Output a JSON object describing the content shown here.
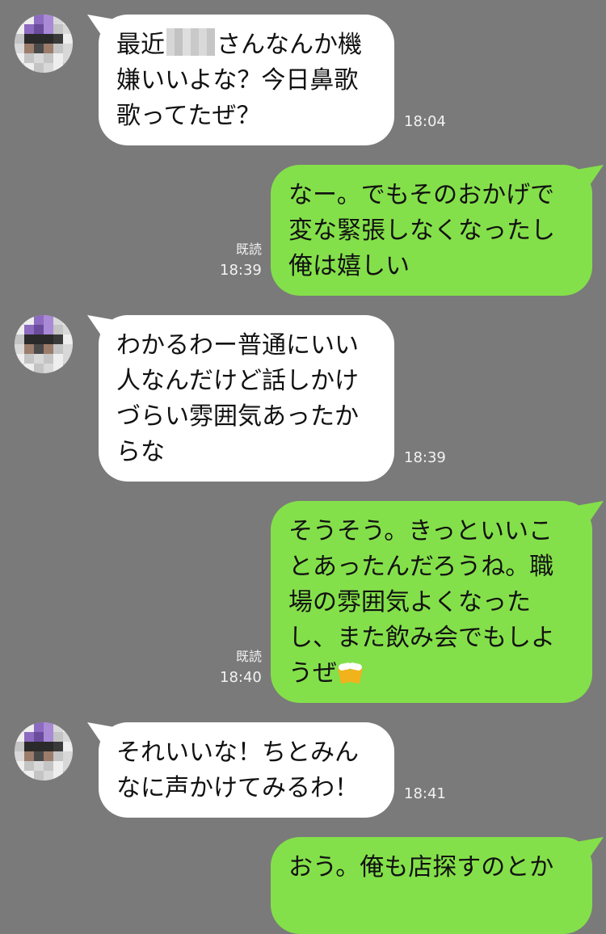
{
  "messages": [
    {
      "side": "in",
      "lines": [
        "最近",
        "さんなんか機",
        "嫌いいよな？今日鼻歌",
        "歌ってたぜ？"
      ],
      "redacted_name": true,
      "time": "18:04"
    },
    {
      "side": "out",
      "lines": [
        "なー。でもそのおかげで",
        "変な緊張しなくなったし",
        "俺は嬉しい"
      ],
      "read_label": "既読",
      "time": "18:39"
    },
    {
      "side": "in",
      "lines": [
        "わかるわー普通にいい",
        "人なんだけど話しかけ",
        "づらい雰囲気あったか",
        "らな"
      ],
      "time": "18:39"
    },
    {
      "side": "out",
      "lines": [
        "そうそう。きっといいこ",
        "とあったんだろうね。職",
        "場の雰囲気よくなった",
        "し、また飲み会でもしよ",
        "うぜ"
      ],
      "emoji": "beer-mugs-icon",
      "read_label": "既読",
      "time": "18:40"
    },
    {
      "side": "in",
      "lines": [
        "それいいな！ちとみん",
        "なに声かけてみるわ！"
      ],
      "time": "18:41"
    },
    {
      "side": "out",
      "lines": [
        "おう。俺も店探すのとか"
      ]
    }
  ],
  "colors": {
    "background": "#7a7a7a",
    "incoming_bubble": "#ffffff",
    "outgoing_bubble": "#84e04a",
    "meta_text": "#f2f2f2"
  }
}
